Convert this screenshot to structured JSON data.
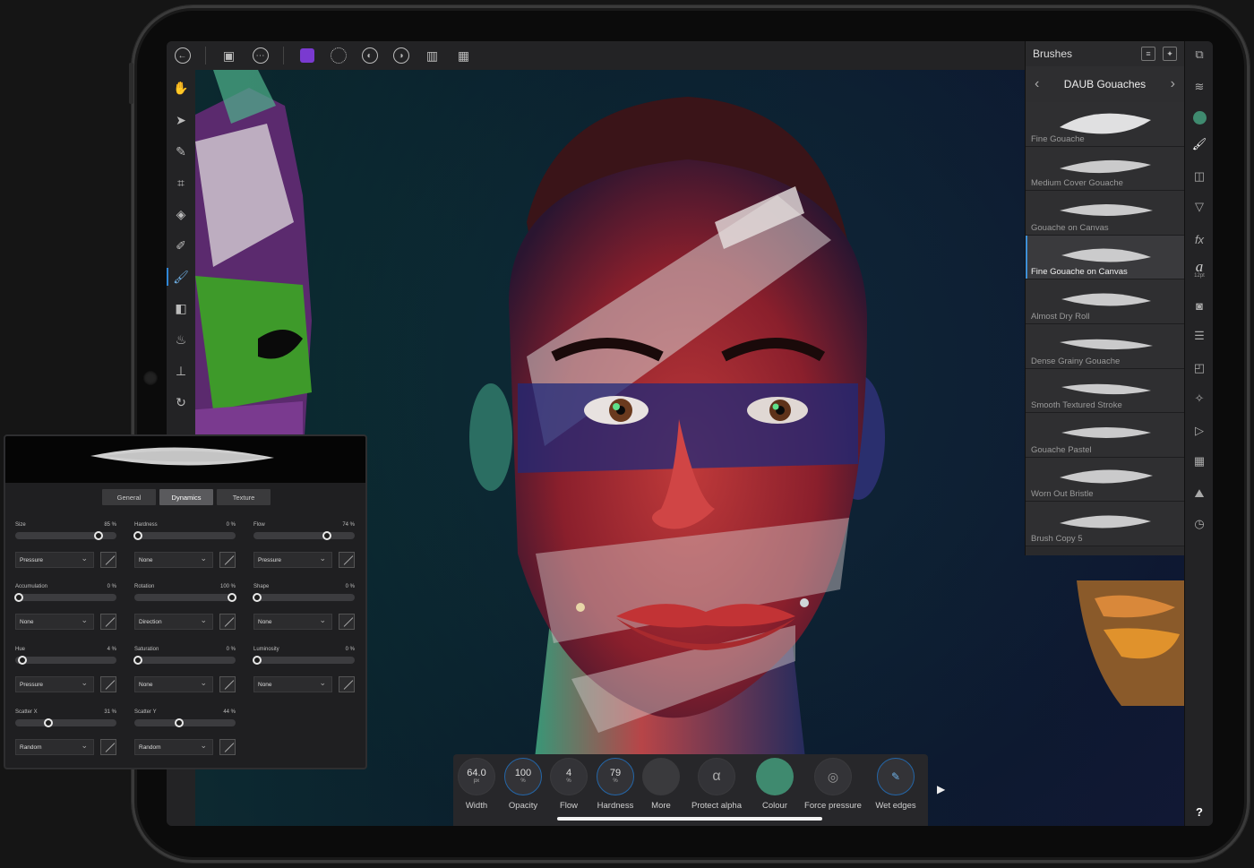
{
  "brushes_panel": {
    "title": "Brushes",
    "category": "DAUB Gouaches",
    "items": [
      {
        "name": "Fine Gouache"
      },
      {
        "name": "Medium Cover Gouache"
      },
      {
        "name": "Gouache on Canvas"
      },
      {
        "name": "Fine Gouache on Canvas",
        "selected": true
      },
      {
        "name": "Almost Dry Roll"
      },
      {
        "name": "Dense Grainy Gouache"
      },
      {
        "name": "Smooth Textured Stroke"
      },
      {
        "name": "Gouache Pastel"
      },
      {
        "name": "Worn Out Bristle"
      },
      {
        "name": "Brush Copy 5"
      }
    ]
  },
  "context_toolbar": {
    "width": {
      "value": "64.0",
      "unit": "px",
      "label": "Width"
    },
    "opacity": {
      "value": "100",
      "unit": "%",
      "label": "Opacity"
    },
    "flow": {
      "value": "4",
      "unit": "%",
      "label": "Flow"
    },
    "hardness": {
      "value": "79",
      "unit": "%",
      "label": "Hardness"
    },
    "more": {
      "label": "More"
    },
    "protect_alpha": {
      "label": "Protect alpha",
      "icon": "alpha-icon"
    },
    "colour": {
      "label": "Colour",
      "value": "#3f8a6f"
    },
    "force_pressure": {
      "label": "Force pressure"
    },
    "wet_edges": {
      "label": "Wet edges"
    }
  },
  "right_studio": {
    "text_size": "12pt",
    "help": "?"
  },
  "brush_editor": {
    "tabs": [
      "General",
      "Dynamics",
      "Texture"
    ],
    "active_tab": "Dynamics",
    "controls": [
      {
        "label": "Size",
        "value": "85 %",
        "frac": 0.85,
        "mode": "Pressure"
      },
      {
        "label": "Hardness",
        "value": "0 %",
        "frac": 0.0,
        "mode": "None"
      },
      {
        "label": "Flow",
        "value": "74 %",
        "frac": 0.74,
        "mode": "Pressure"
      },
      {
        "label": "Accumulation",
        "value": "0 %",
        "frac": 0.0,
        "mode": "None"
      },
      {
        "label": "Rotation",
        "value": "100 %",
        "frac": 1.0,
        "mode": "Direction"
      },
      {
        "label": "Shape",
        "value": "0 %",
        "frac": 0.0,
        "mode": "None"
      },
      {
        "label": "Hue",
        "value": "4 %",
        "frac": 0.04,
        "mode": "Pressure"
      },
      {
        "label": "Saturation",
        "value": "0 %",
        "frac": 0.0,
        "mode": "None"
      },
      {
        "label": "Luminosity",
        "value": "0 %",
        "frac": 0.0,
        "mode": "None"
      },
      {
        "label": "Scatter X",
        "value": "31 %",
        "frac": 0.31,
        "mode": "Random"
      },
      {
        "label": "Scatter Y",
        "value": "44 %",
        "frac": 0.44,
        "mode": "Random"
      }
    ]
  },
  "colors": {
    "accent": "#2f86d6",
    "panel": "#2a2a2c",
    "colour_swatch": "#3f8a6f"
  }
}
